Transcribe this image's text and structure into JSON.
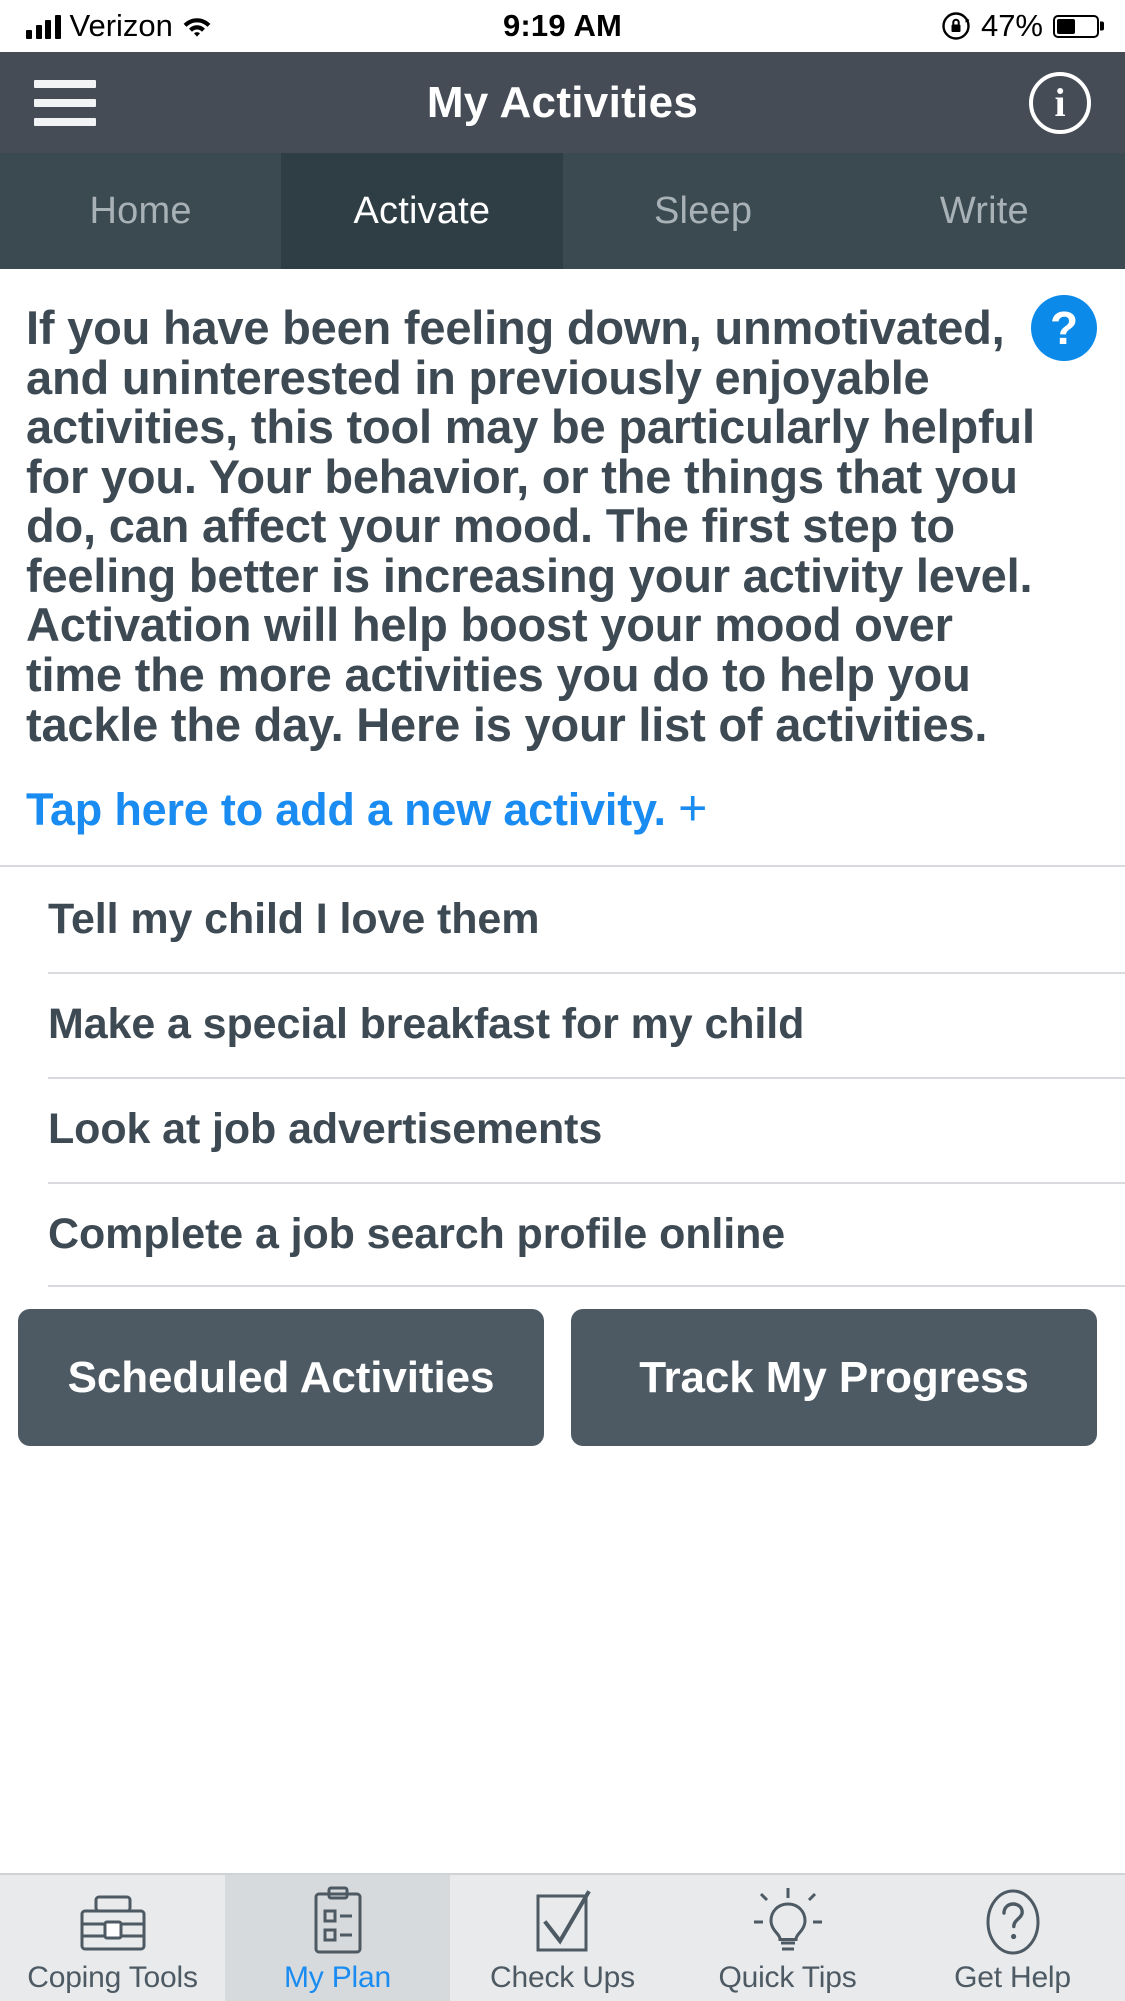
{
  "status_bar": {
    "carrier": "Verizon",
    "time": "9:19 AM",
    "battery_percent": "47%",
    "signal_icon": "cellular-signal-icon",
    "wifi_icon": "wifi-icon",
    "rotation_lock_icon": "rotation-lock-icon",
    "battery_icon": "battery-icon"
  },
  "header": {
    "title": "My Activities",
    "menu_icon": "hamburger-menu-icon",
    "info_icon": "info-icon",
    "info_label": "i",
    "background": "#454c55"
  },
  "tabs": {
    "items": [
      {
        "label": "Home",
        "active": false
      },
      {
        "label": "Activate",
        "active": true
      },
      {
        "label": "Sleep",
        "active": false
      },
      {
        "label": "Write",
        "active": false
      }
    ],
    "active_background": "#2f3e45",
    "inactive_background": "#3b4a51"
  },
  "main": {
    "intro_text": "If you have been feeling down, unmotivated, and uninterested in previously enjoyable activities, this tool may be particularly helpful for you. Your behavior, or the things that you do, can affect your mood. The first step to feeling better is increasing your activity level. Activation will help boost your mood over time the more activities you do to help you tackle the day. Here is your list of activities.",
    "help_button_label": "?",
    "help_button_color": "#0b8ae9",
    "add_activity_label": "Tap here to add a new activity.",
    "add_activity_plus": "+",
    "link_color": "#1a8cf1",
    "activities": [
      "Tell my child I love them",
      "Make a special breakfast for my child",
      "Look at job advertisements",
      "Complete a job search profile online"
    ],
    "buttons": [
      {
        "label": "Scheduled Activities"
      },
      {
        "label": "Track My Progress"
      }
    ],
    "button_color": "#4d5a63",
    "text_color": "#3e4a53"
  },
  "bottom_nav": {
    "items": [
      {
        "label": "Coping Tools",
        "icon": "toolbox-icon",
        "active": false
      },
      {
        "label": "My Plan",
        "icon": "clipboard-checklist-icon",
        "active": true
      },
      {
        "label": "Check Ups",
        "icon": "checkmark-square-icon",
        "active": false
      },
      {
        "label": "Quick Tips",
        "icon": "lightbulb-icon",
        "active": false
      },
      {
        "label": "Get Help",
        "icon": "question-circle-icon",
        "active": false
      }
    ],
    "active_label_color": "#1a8cf1",
    "background": "#e8eaec"
  }
}
